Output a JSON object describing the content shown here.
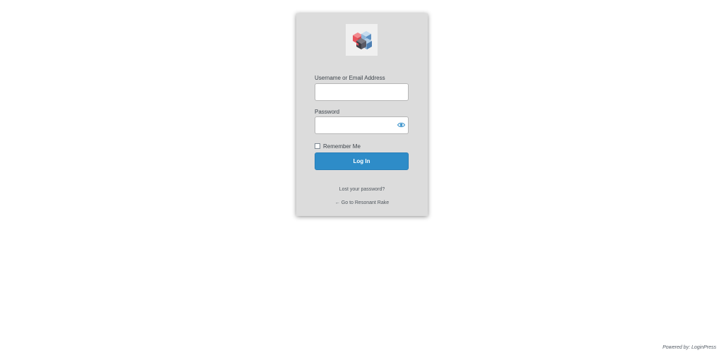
{
  "logo": {
    "icon": "cube-logo-icon",
    "colors": [
      "#e8535c",
      "#4a4a52",
      "#8fb6d9",
      "#5c8fc1"
    ]
  },
  "form": {
    "username_label": "Username or Email Address",
    "username_value": "",
    "password_label": "Password",
    "password_value": "",
    "password_toggle_icon": "eye-icon",
    "remember_label": "Remember Me",
    "remember_checked": false,
    "submit_label": "Log In"
  },
  "links": {
    "lost_password": "Lost your password?",
    "back_to_site": "← Go to Resonant Rake"
  },
  "footer": {
    "powered_by": "Powered by: LoginPress"
  },
  "colors": {
    "card_background": "#dcdcdc",
    "button": "#2e8cc8",
    "eye_icon": "#2e8cc8"
  }
}
